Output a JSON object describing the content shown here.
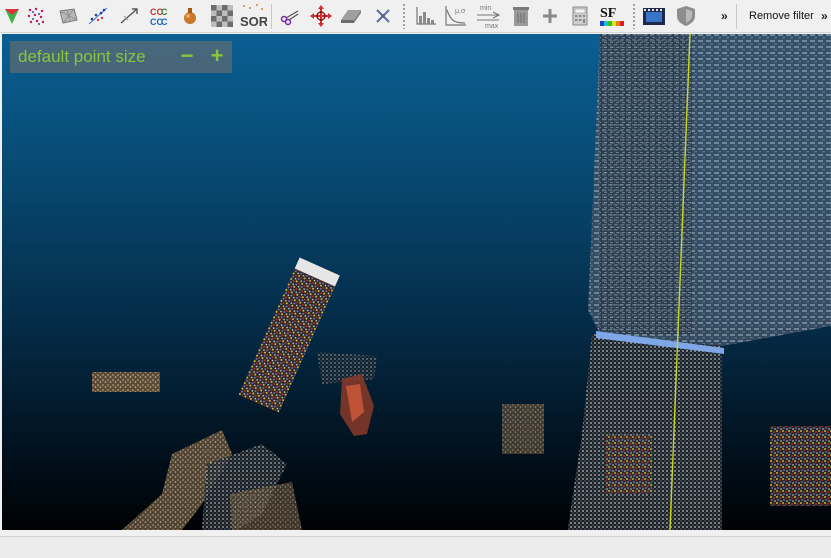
{
  "toolbar": {
    "tools": [
      {
        "icon": "compute-normals-icon"
      },
      {
        "icon": "point-cloud-icon"
      },
      {
        "icon": "mesh-icon"
      },
      {
        "icon": "subsample-icon"
      },
      {
        "icon": "registration-icon"
      },
      {
        "icon": "cloud-to-cloud-distance-icon",
        "label": "CCCC"
      },
      {
        "icon": "potion-icon"
      },
      {
        "icon": "rasterize-icon"
      },
      {
        "icon": "sor-filter-icon",
        "label": "SOR"
      },
      {
        "icon": "scissors-icon"
      },
      {
        "icon": "translate-rotate-icon"
      },
      {
        "icon": "plane-icon"
      },
      {
        "icon": "point-picking-icon"
      },
      {
        "icon": "histogram-icon"
      },
      {
        "icon": "scalar-field-curve-icon",
        "label": "μ,σ"
      },
      {
        "icon": "min-max-filter-icon",
        "label_top": "min",
        "label_bottom": "max"
      },
      {
        "icon": "sf-delete-icon"
      },
      {
        "icon": "add-icon"
      },
      {
        "icon": "calculator-icon"
      },
      {
        "icon": "sf-color-scale-icon",
        "label": "SF"
      },
      {
        "icon": "film-strip-icon"
      },
      {
        "icon": "shield-icon"
      }
    ],
    "overflow_chevron": "»",
    "remove_filter_label": "Remove filter",
    "overflow_chevron_right": "»"
  },
  "viewport": {
    "point_size_overlay": {
      "label": "default point size",
      "minus": "−",
      "plus": "+"
    }
  },
  "status": {
    "text": ""
  },
  "colors": {
    "accent_green": "#8ac53c",
    "background_top": "#0a5f93",
    "background_bottom": "#000205"
  }
}
